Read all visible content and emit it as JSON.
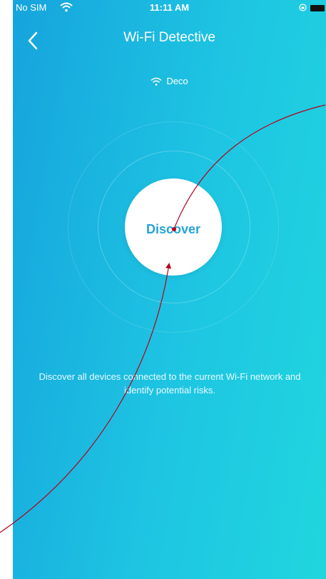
{
  "status_bar": {
    "carrier": "No SIM",
    "time": "11:11 AM"
  },
  "header": {
    "title": "Wi-Fi Detective",
    "back_icon": "chevron-left-icon"
  },
  "network": {
    "icon": "wifi-icon",
    "name": "Deco"
  },
  "main": {
    "discover_label": "Discover",
    "description": "Discover all devices connected to the current Wi-Fi network and identify potential risks."
  },
  "colors": {
    "background_start": "#16a4dd",
    "background_end": "#20d6de",
    "button_text": "#27a3d7",
    "annotation": "#b3001b"
  }
}
